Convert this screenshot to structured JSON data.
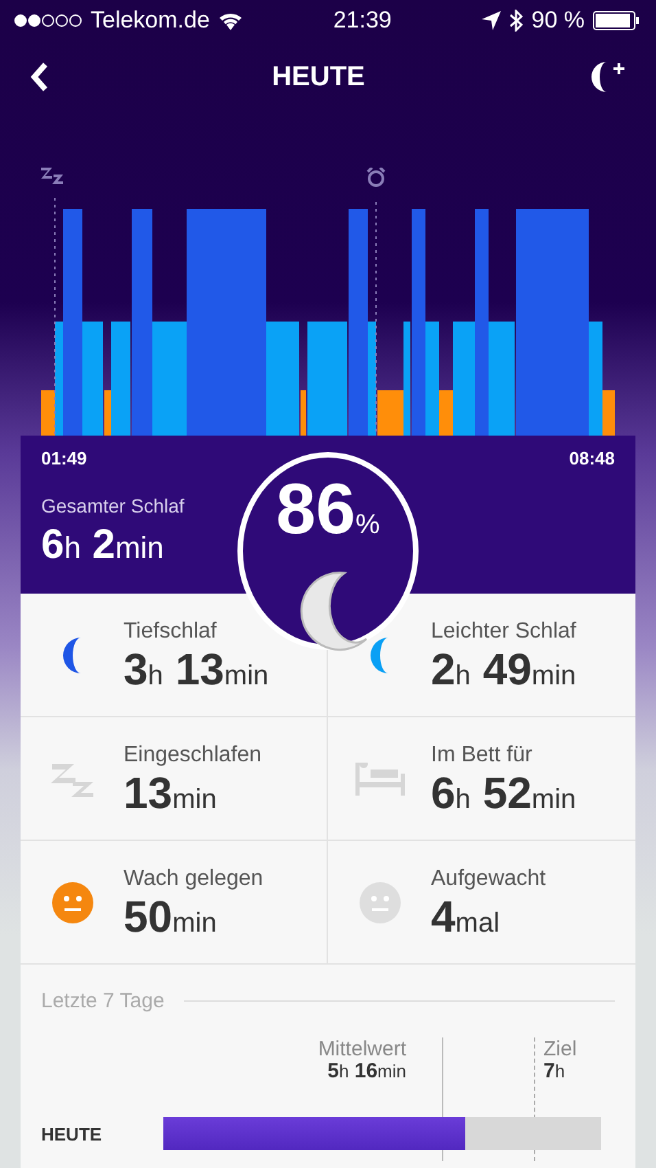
{
  "status_bar": {
    "carrier": "Telekom.de",
    "time": "21:39",
    "battery": "90 %"
  },
  "header": {
    "title": "HEUTE"
  },
  "sleep_chart": {
    "start_time": "01:49",
    "end_time": "08:48"
  },
  "summary": {
    "label": "Gesamter Schlaf",
    "value": [
      {
        "number": "6",
        "unit": "h"
      },
      {
        "number": "2",
        "unit": "min"
      }
    ],
    "score": "86",
    "score_unit": "%"
  },
  "stats": [
    {
      "kind": "deep",
      "label": "Tiefschlaf",
      "value": [
        {
          "number": "3",
          "unit": "h"
        },
        {
          "number": "13",
          "unit": "min"
        }
      ]
    },
    {
      "kind": "light",
      "label": "Leichter Schlaf",
      "value": [
        {
          "number": "2",
          "unit": "h"
        },
        {
          "number": "49",
          "unit": "min"
        }
      ]
    },
    {
      "kind": "asleep",
      "label": "Eingeschlafen",
      "value": [
        {
          "number": "13",
          "unit": "min"
        }
      ]
    },
    {
      "kind": "bed",
      "label": "Im Bett für",
      "value": [
        {
          "number": "6",
          "unit": "h"
        },
        {
          "number": "52",
          "unit": "min"
        }
      ]
    },
    {
      "kind": "awake",
      "label": "Wach gelegen",
      "value": [
        {
          "number": "50",
          "unit": "min"
        }
      ]
    },
    {
      "kind": "woke",
      "label": "Aufgewacht",
      "value": [
        {
          "number": "4",
          "unit": "mal"
        }
      ]
    }
  ],
  "last_7_days": {
    "title": "Letzte 7 Tage",
    "average": {
      "label": "Mittelwert",
      "value": [
        {
          "number": "5",
          "unit": "h"
        },
        {
          "number": "16",
          "unit": "min"
        }
      ]
    },
    "goal": {
      "label": "Ziel",
      "value": [
        {
          "number": "7",
          "unit": "h"
        }
      ]
    },
    "rows": [
      {
        "label": "HEUTE",
        "level": 0.69
      }
    ]
  }
}
